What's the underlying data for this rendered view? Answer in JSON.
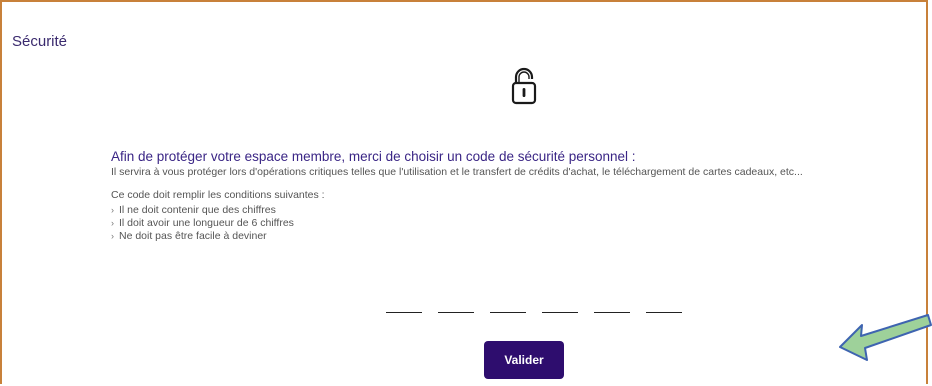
{
  "section": {
    "title": "Sécurité"
  },
  "intro": {
    "headline": "Afin de protéger votre espace membre, merci de choisir un code de sécurité personnel :",
    "description": "Il servira à vous protéger lors d'opérations critiques telles que l'utilisation et le transfert de crédits d'achat, le téléchargement de cartes cadeaux, etc..."
  },
  "conditions": {
    "title": "Ce code doit remplir les conditions suivantes :",
    "items": [
      "Il ne doit contenir que des chiffres",
      "Il doit avoir une longueur de 6 chiffres",
      "Ne doit pas être facile à deviner"
    ]
  },
  "code": {
    "digits": [
      "",
      "",
      "",
      "",
      "",
      ""
    ]
  },
  "actions": {
    "validate_label": "Valider"
  },
  "icons": {
    "lock": "unlocked-padlock-icon",
    "arrow": "arrow-icon"
  },
  "colors": {
    "accent": "#2e0d6e",
    "border": "#c8813a",
    "arrow_fill": "#9ed19a",
    "arrow_stroke": "#3e64b0"
  }
}
